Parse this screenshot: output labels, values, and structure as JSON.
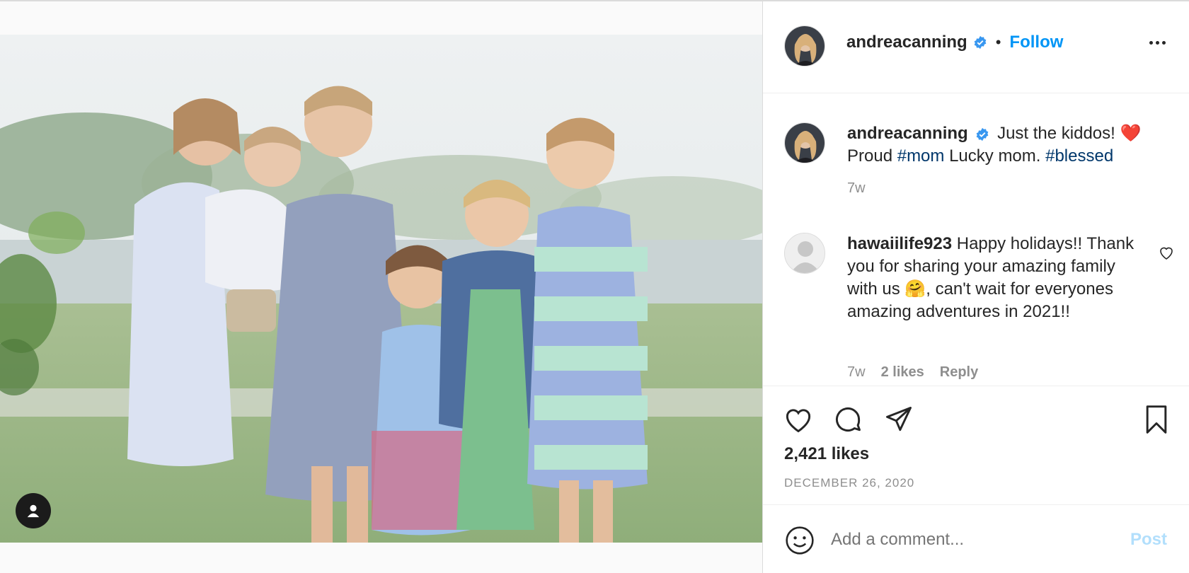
{
  "post": {
    "username": "andreacanning",
    "follow_label": "Follow",
    "separator": "•",
    "icons": {
      "verified": "verified-badge-icon",
      "more": "more-options-icon",
      "like": "heart-icon",
      "comment": "comment-icon",
      "share": "share-icon",
      "save": "bookmark-icon",
      "emoji": "emoji-icon",
      "tag": "user-tag-icon"
    }
  },
  "caption": {
    "username": "andreacanning",
    "text_before": "Just the kiddos! ❤️ Proud ",
    "hashtag1": "#mom",
    "text_middle": " Lucky mom. ",
    "hashtag2": "#blessed",
    "time": "7w"
  },
  "comment": {
    "username": "hawaiilife923",
    "text": "Happy holidays!! Thank you for sharing your amazing family with us 🤗, can't wait for everyones amazing adventures in 2021!!",
    "time": "7w",
    "likes": "2 likes",
    "reply": "Reply"
  },
  "stats": {
    "likes": "2,421 likes",
    "date": "DECEMBER 26, 2020"
  },
  "add_comment": {
    "placeholder": "Add a comment...",
    "post_label": "Post"
  },
  "colors": {
    "accent": "#0095f6",
    "hashtag": "#00376b",
    "muted": "#8e8e8e",
    "post_disabled": "#b2dffc"
  }
}
